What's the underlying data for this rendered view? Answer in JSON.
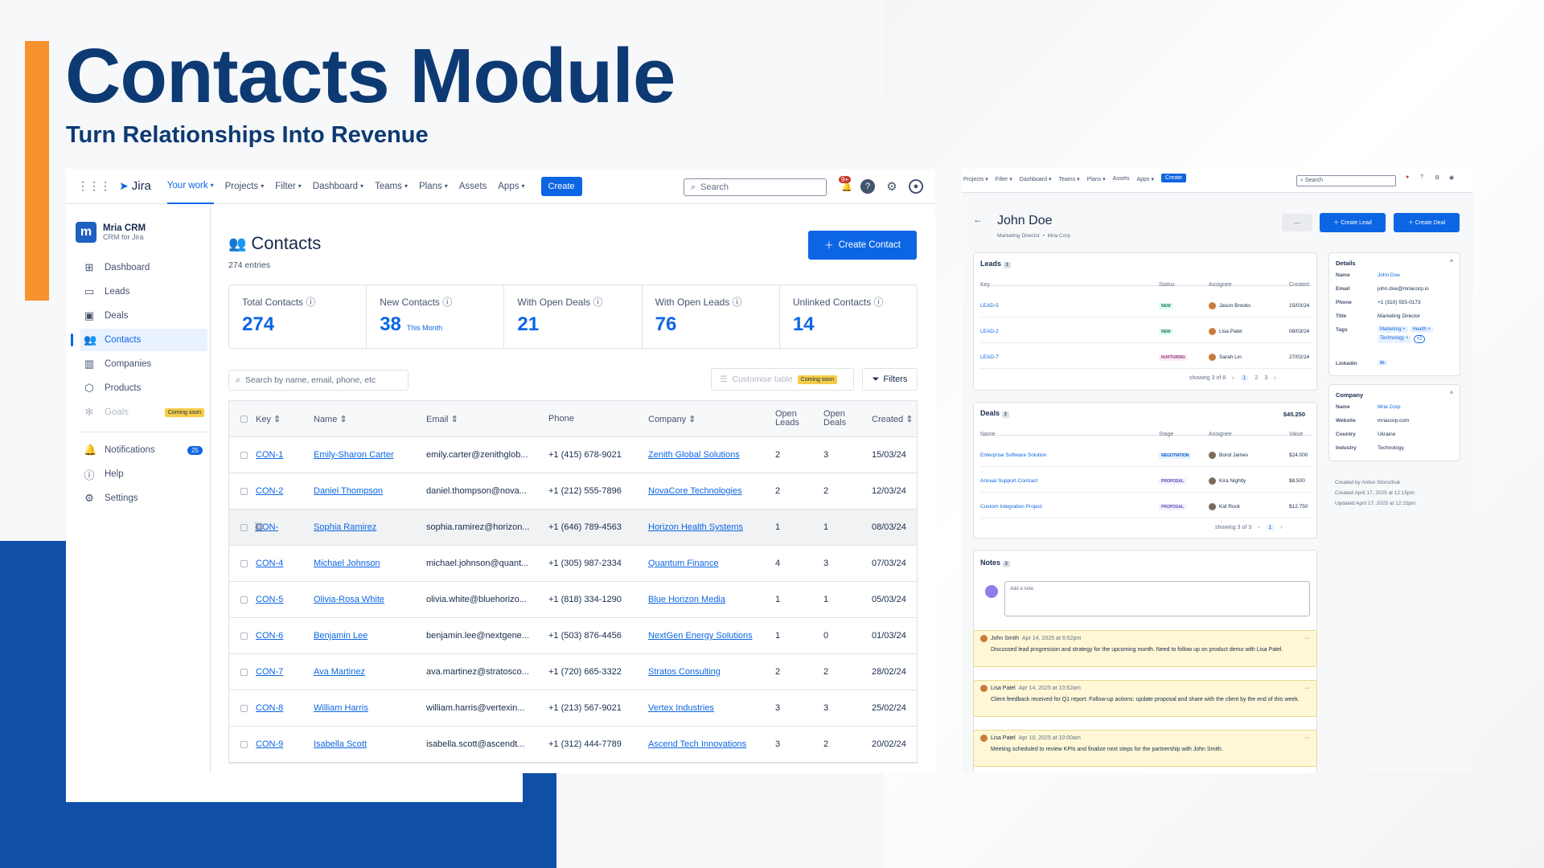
{
  "slide": {
    "title": "Contacts Module",
    "subtitle": "Turn Relationships Into Revenue"
  },
  "colors": {
    "accent_orange": "#f7922e",
    "brand_navy": "#0d3a73",
    "deco_blue": "#0f4fa8",
    "link_blue": "#0c66e4"
  },
  "jira": {
    "logo": "Jira",
    "nav": [
      "Your work",
      "Projects",
      "Filter",
      "Dashboard",
      "Teams",
      "Plans",
      "Assets",
      "Apps"
    ],
    "create": "Create",
    "search_placeholder": "Search",
    "notif_badge": "9+"
  },
  "app": {
    "name": "Mria CRM",
    "sub": "CRM for Jira",
    "logo_letter": "m"
  },
  "sidebar": [
    {
      "label": "Dashboard",
      "icon": "grid-icon"
    },
    {
      "label": "Leads",
      "icon": "inbox-icon"
    },
    {
      "label": "Deals",
      "icon": "deal-icon"
    },
    {
      "label": "Contacts",
      "icon": "people-icon"
    },
    {
      "label": "Companies",
      "icon": "building-icon"
    },
    {
      "label": "Products",
      "icon": "box-icon"
    },
    {
      "label": "Goals",
      "icon": "goal-icon",
      "badge": "Coming soon"
    }
  ],
  "sidebar_bottom": [
    {
      "label": "Notifications",
      "icon": "bell-icon",
      "badge": "25"
    },
    {
      "label": "Help",
      "icon": "help-icon"
    },
    {
      "label": "Settings",
      "icon": "gear-icon"
    }
  ],
  "contacts": {
    "title": "Contacts",
    "entries": "274 entries",
    "create_btn": "Create Contact",
    "stats": [
      {
        "label": "Total Contacts",
        "value": "274",
        "sub": ""
      },
      {
        "label": "New Contacts",
        "value": "38",
        "sub": "This Month"
      },
      {
        "label": "With Open Deals",
        "value": "21",
        "sub": ""
      },
      {
        "label": "With Open Leads",
        "value": "76",
        "sub": ""
      },
      {
        "label": "Unlinked Contacts",
        "value": "14",
        "sub": ""
      }
    ],
    "search_placeholder": "Search by name, email, phone, etc",
    "customise": "Customise table",
    "coming_soon": "Coming soon",
    "filters": "Filters",
    "columns": [
      "Key",
      "Name",
      "Email",
      "Phone",
      "Company",
      "Open Leads",
      "Open Deals",
      "Created"
    ],
    "rows": [
      [
        "CON-1",
        "Emily-Sharon Carter",
        "emily.carter@zenithglob...",
        "+1 (415) 678-9021",
        "Zenith Global Solutions",
        "2",
        "3",
        "15/03/24"
      ],
      [
        "CON-2",
        "Daniel Thompson",
        "daniel.thompson@nova...",
        "+1 (212) 555-7896",
        "NovaCore Technologies",
        "2",
        "2",
        "12/03/24"
      ],
      [
        "CON-",
        "Sophia Ramirez",
        "sophia.ramirez@horizon...",
        "+1 (646) 789-4563",
        "Horizon Health Systems",
        "1",
        "1",
        "08/03/24"
      ],
      [
        "CON-4",
        "Michael Johnson",
        "michael.johnson@quant...",
        "+1 (305) 987-2334",
        "Quantum Finance",
        "4",
        "3",
        "07/03/24"
      ],
      [
        "CON-5",
        "Olivia-Rosa White",
        "olivia.white@bluehorizo...",
        "+1 (818) 334-1290",
        "Blue Horizon Media",
        "1",
        "1",
        "05/03/24"
      ],
      [
        "CON-6",
        "Benjamin Lee",
        "benjamin.lee@nextgene...",
        "+1 (503) 876-4456",
        "NextGen Energy Solutions",
        "1",
        "0",
        "01/03/24"
      ],
      [
        "CON-7",
        "Ava Martinez",
        "ava.martinez@stratosco...",
        "+1 (720) 665-3322",
        "Stratos Consulting",
        "2",
        "2",
        "28/02/24"
      ],
      [
        "CON-8",
        "William Harris",
        "william.harris@vertexin...",
        "+1 (213) 567-9021",
        "Vertex Industries",
        "3",
        "3",
        "25/02/24"
      ],
      [
        "CON-9",
        "Isabella Scott",
        "isabella.scott@ascendt...",
        "+1 (312) 444-7789",
        "Ascend Tech Innovations",
        "3",
        "2",
        "20/02/24"
      ]
    ]
  },
  "detail": {
    "nav": [
      "Projects",
      "Filter",
      "Dashboard",
      "Teams",
      "Plans",
      "Assets",
      "Apps"
    ],
    "create": "Create",
    "search": "Search",
    "name": "John Doe",
    "role": "Marketing Director",
    "company": "Mria Corp",
    "more": "···",
    "create_lead": "Create Lead",
    "create_deal": "Create Deal",
    "leads": {
      "title": "Leads",
      "count": "3",
      "columns": [
        "Key",
        "Status",
        "Assignee",
        "Created"
      ],
      "rows": [
        {
          "key": "LEAD-5",
          "status": "NEW",
          "assignee": "Jason Brooks",
          "created": "15/03/24"
        },
        {
          "key": "LEAD-2",
          "status": "NEW",
          "assignee": "Lisa Patel",
          "created": "08/03/24"
        },
        {
          "key": "LEAD-7",
          "status": "NURTURING",
          "assignee": "Sarah Lin",
          "created": "27/02/24"
        }
      ],
      "showing": "showing 3 of 8",
      "pages": [
        "1",
        "2",
        "3"
      ]
    },
    "deals": {
      "title": "Deals",
      "count": "3",
      "total": "$45.250",
      "columns": [
        "Name",
        "Stage",
        "Assignee",
        "Value"
      ],
      "rows": [
        {
          "name": "Enterprise Software Solution",
          "stage": "NEGOTIATION",
          "assignee": "Bond James",
          "value": "$24.000"
        },
        {
          "name": "Annual Support Contract",
          "stage": "PROPOSAL",
          "assignee": "Kira Nightly",
          "value": "$8.500"
        },
        {
          "name": "Custom Integration Project",
          "stage": "PROPOSAL",
          "assignee": "Kid Rock",
          "value": "$12.750"
        }
      ],
      "showing": "showing 3 of 3",
      "page": "1"
    },
    "notes": {
      "title": "Notes",
      "count": "3",
      "placeholder": "Add a note",
      "items": [
        {
          "author": "John Smith",
          "date": "Apr 14, 2025 at 6:52pm",
          "text": "Discussed lead progression and strategy for the upcoming month. Need to follow up on product demo with Lisa Patel."
        },
        {
          "author": "Lisa Patel",
          "date": "Apr 14, 2025 at 10:52am",
          "text": "Client feedback received for Q1 report. Follow-up actions: update proposal and share with the client by the end of this week."
        },
        {
          "author": "Lisa Patel",
          "date": "Apr 10, 2025 at 10:00am",
          "text": "Meeting scheduled to review KPIs and finalize next steps for the partnership with John Smith."
        }
      ]
    },
    "details": {
      "title": "Details",
      "fields": [
        {
          "k": "Name",
          "v": "John Doe"
        },
        {
          "k": "Email",
          "v": "john.doe@mriacorp.io"
        },
        {
          "k": "Phone",
          "v": "+1 (310) 555-0173"
        },
        {
          "k": "Title",
          "v": "Marketing Director"
        }
      ],
      "tags_label": "Tags",
      "tags": [
        "Marketing ×",
        "Health ×",
        "Technology ×",
        "+2"
      ],
      "linkedin_label": "Linkedin",
      "linkedin": "in"
    },
    "company_card": {
      "title": "Company",
      "fields": [
        {
          "k": "Name",
          "v": "Mria Corp"
        },
        {
          "k": "Website",
          "v": "mriacorp.com"
        },
        {
          "k": "Country",
          "v": "Ukraine"
        },
        {
          "k": "Industry",
          "v": "Technology"
        }
      ]
    },
    "meta": [
      "Created by Anton Storozhuk",
      "Created April 17, 2025 at 12:15pm",
      "Updated April 17, 2025 at 12:15pm"
    ]
  }
}
